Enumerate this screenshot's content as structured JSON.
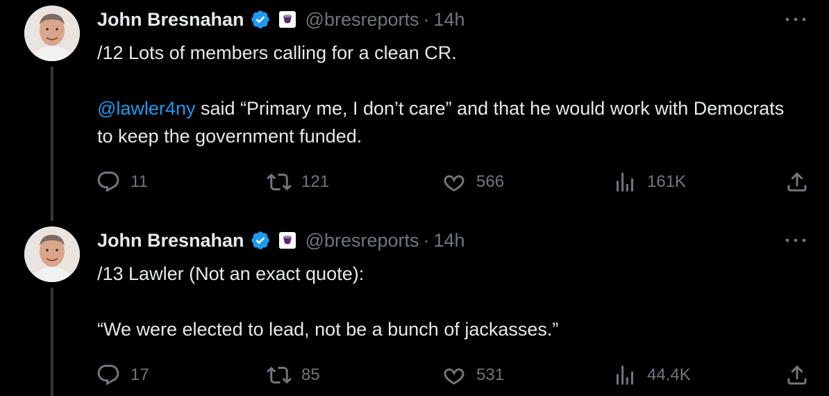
{
  "tweets": [
    {
      "author": {
        "name": "John Bresnahan",
        "handle": "@bresreports",
        "verified": true,
        "badge_icon": "affiliate-badge-icon"
      },
      "separator": "·",
      "time": "14h",
      "text_lines": [
        "/12 Lots of members calling for a clean CR."
      ],
      "mention": "@lawler4ny",
      "text_after_mention": " said “Primary me, I don’t care” and that he would work with Democrats to keep the government funded.",
      "stats": {
        "replies": "11",
        "reposts": "121",
        "likes": "566",
        "views": "161K"
      }
    },
    {
      "author": {
        "name": "John Bresnahan",
        "handle": "@bresreports",
        "verified": true,
        "badge_icon": "affiliate-badge-icon"
      },
      "separator": "·",
      "time": "14h",
      "text_lines": [
        "/13 Lawler (Not an exact quote):",
        "“We were elected to lead, not be a bunch of jackasses.”"
      ],
      "stats": {
        "replies": "17",
        "reposts": "85",
        "likes": "531",
        "views": "44.4K"
      }
    }
  ],
  "colors": {
    "background": "#000000",
    "text": "#e7e9ea",
    "muted": "#71767b",
    "accent": "#1d9bf0",
    "thread_line": "#333639"
  }
}
